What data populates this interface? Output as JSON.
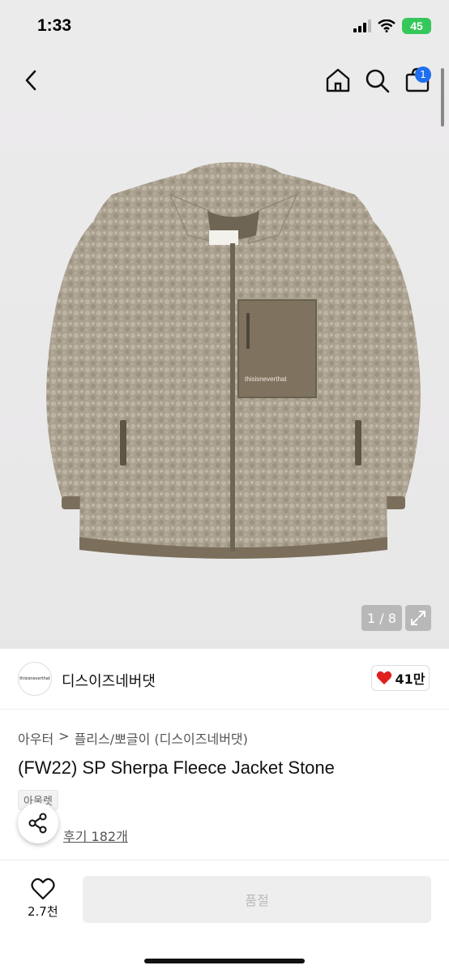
{
  "status_bar": {
    "time": "1:33",
    "battery": "45"
  },
  "nav": {
    "cart_count": "1"
  },
  "gallery": {
    "counter": "1 / 8"
  },
  "brand": {
    "logo_text": "thisisneverthat",
    "name": "디스이즈네버댓",
    "likes": "41만"
  },
  "product": {
    "breadcrumb": [
      "아우터",
      "플리스/뽀글이 (디스이즈네버댓)"
    ],
    "breadcrumb_sep": ">",
    "title": "(FW22) SP Sherpa Fleece Jacket Stone",
    "badge": "아울렛",
    "reviews": "후기 182개"
  },
  "bottom_bar": {
    "wish_count": "2.7천",
    "status_button": "품절"
  },
  "colors": {
    "accent_blue": "#1f6ff0",
    "like_red": "#e02020",
    "battery_green": "#35c759"
  }
}
